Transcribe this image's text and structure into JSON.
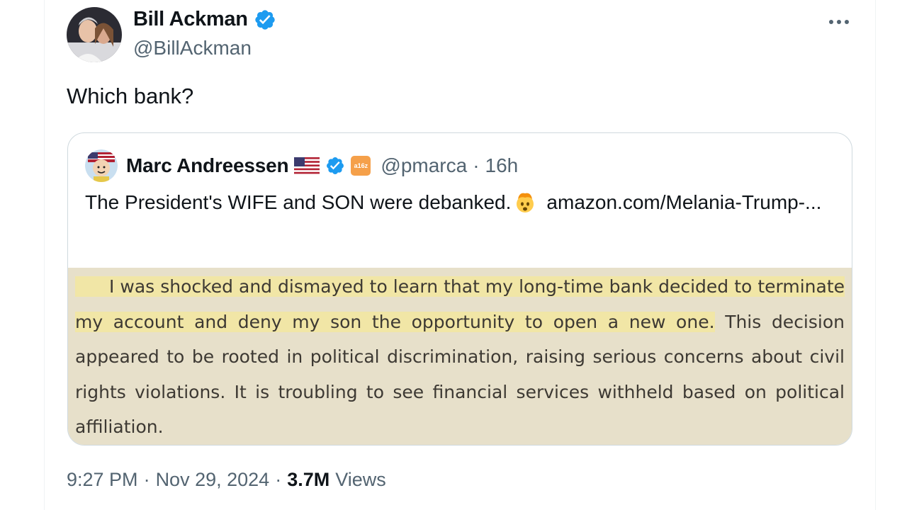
{
  "author": {
    "name": "Bill Ackman",
    "handle": "@BillAckman"
  },
  "tweet": {
    "text": "Which bank?",
    "time": "9:27 PM",
    "date": "Nov 29, 2024",
    "separator": "·",
    "views_count": "3.7M",
    "views_label": "Views"
  },
  "quote": {
    "name": "Marc Andreessen",
    "badge_text": "a16z",
    "handle": "@pmarca",
    "separator": "·",
    "age": "16h",
    "text": "The President's WIFE and SON were debanked.",
    "link": "amazon.com/Melania-Trump-...",
    "image_excerpt": {
      "highlighted": "I was shocked and dismayed to learn that my long-time bank decided to terminate my account and deny my son the opportunity to open a new one.",
      "rest": " This decision appeared to be rooted in political discrimination, raising serious concerns about civil rights violations. It is troubling to see financial services withheld based on political affiliation."
    }
  },
  "icons": {
    "verified": "verified-badge-icon",
    "more": "more-horizontal-icon",
    "flag": "us-flag-icon",
    "emoji": "exploding-head-emoji-icon"
  },
  "colors": {
    "verified_blue": "#1d9bf0",
    "text_primary": "#0f1419",
    "text_secondary": "#536471",
    "highlight": "#f1e6a6",
    "page_tint": "#e7e0ca"
  }
}
